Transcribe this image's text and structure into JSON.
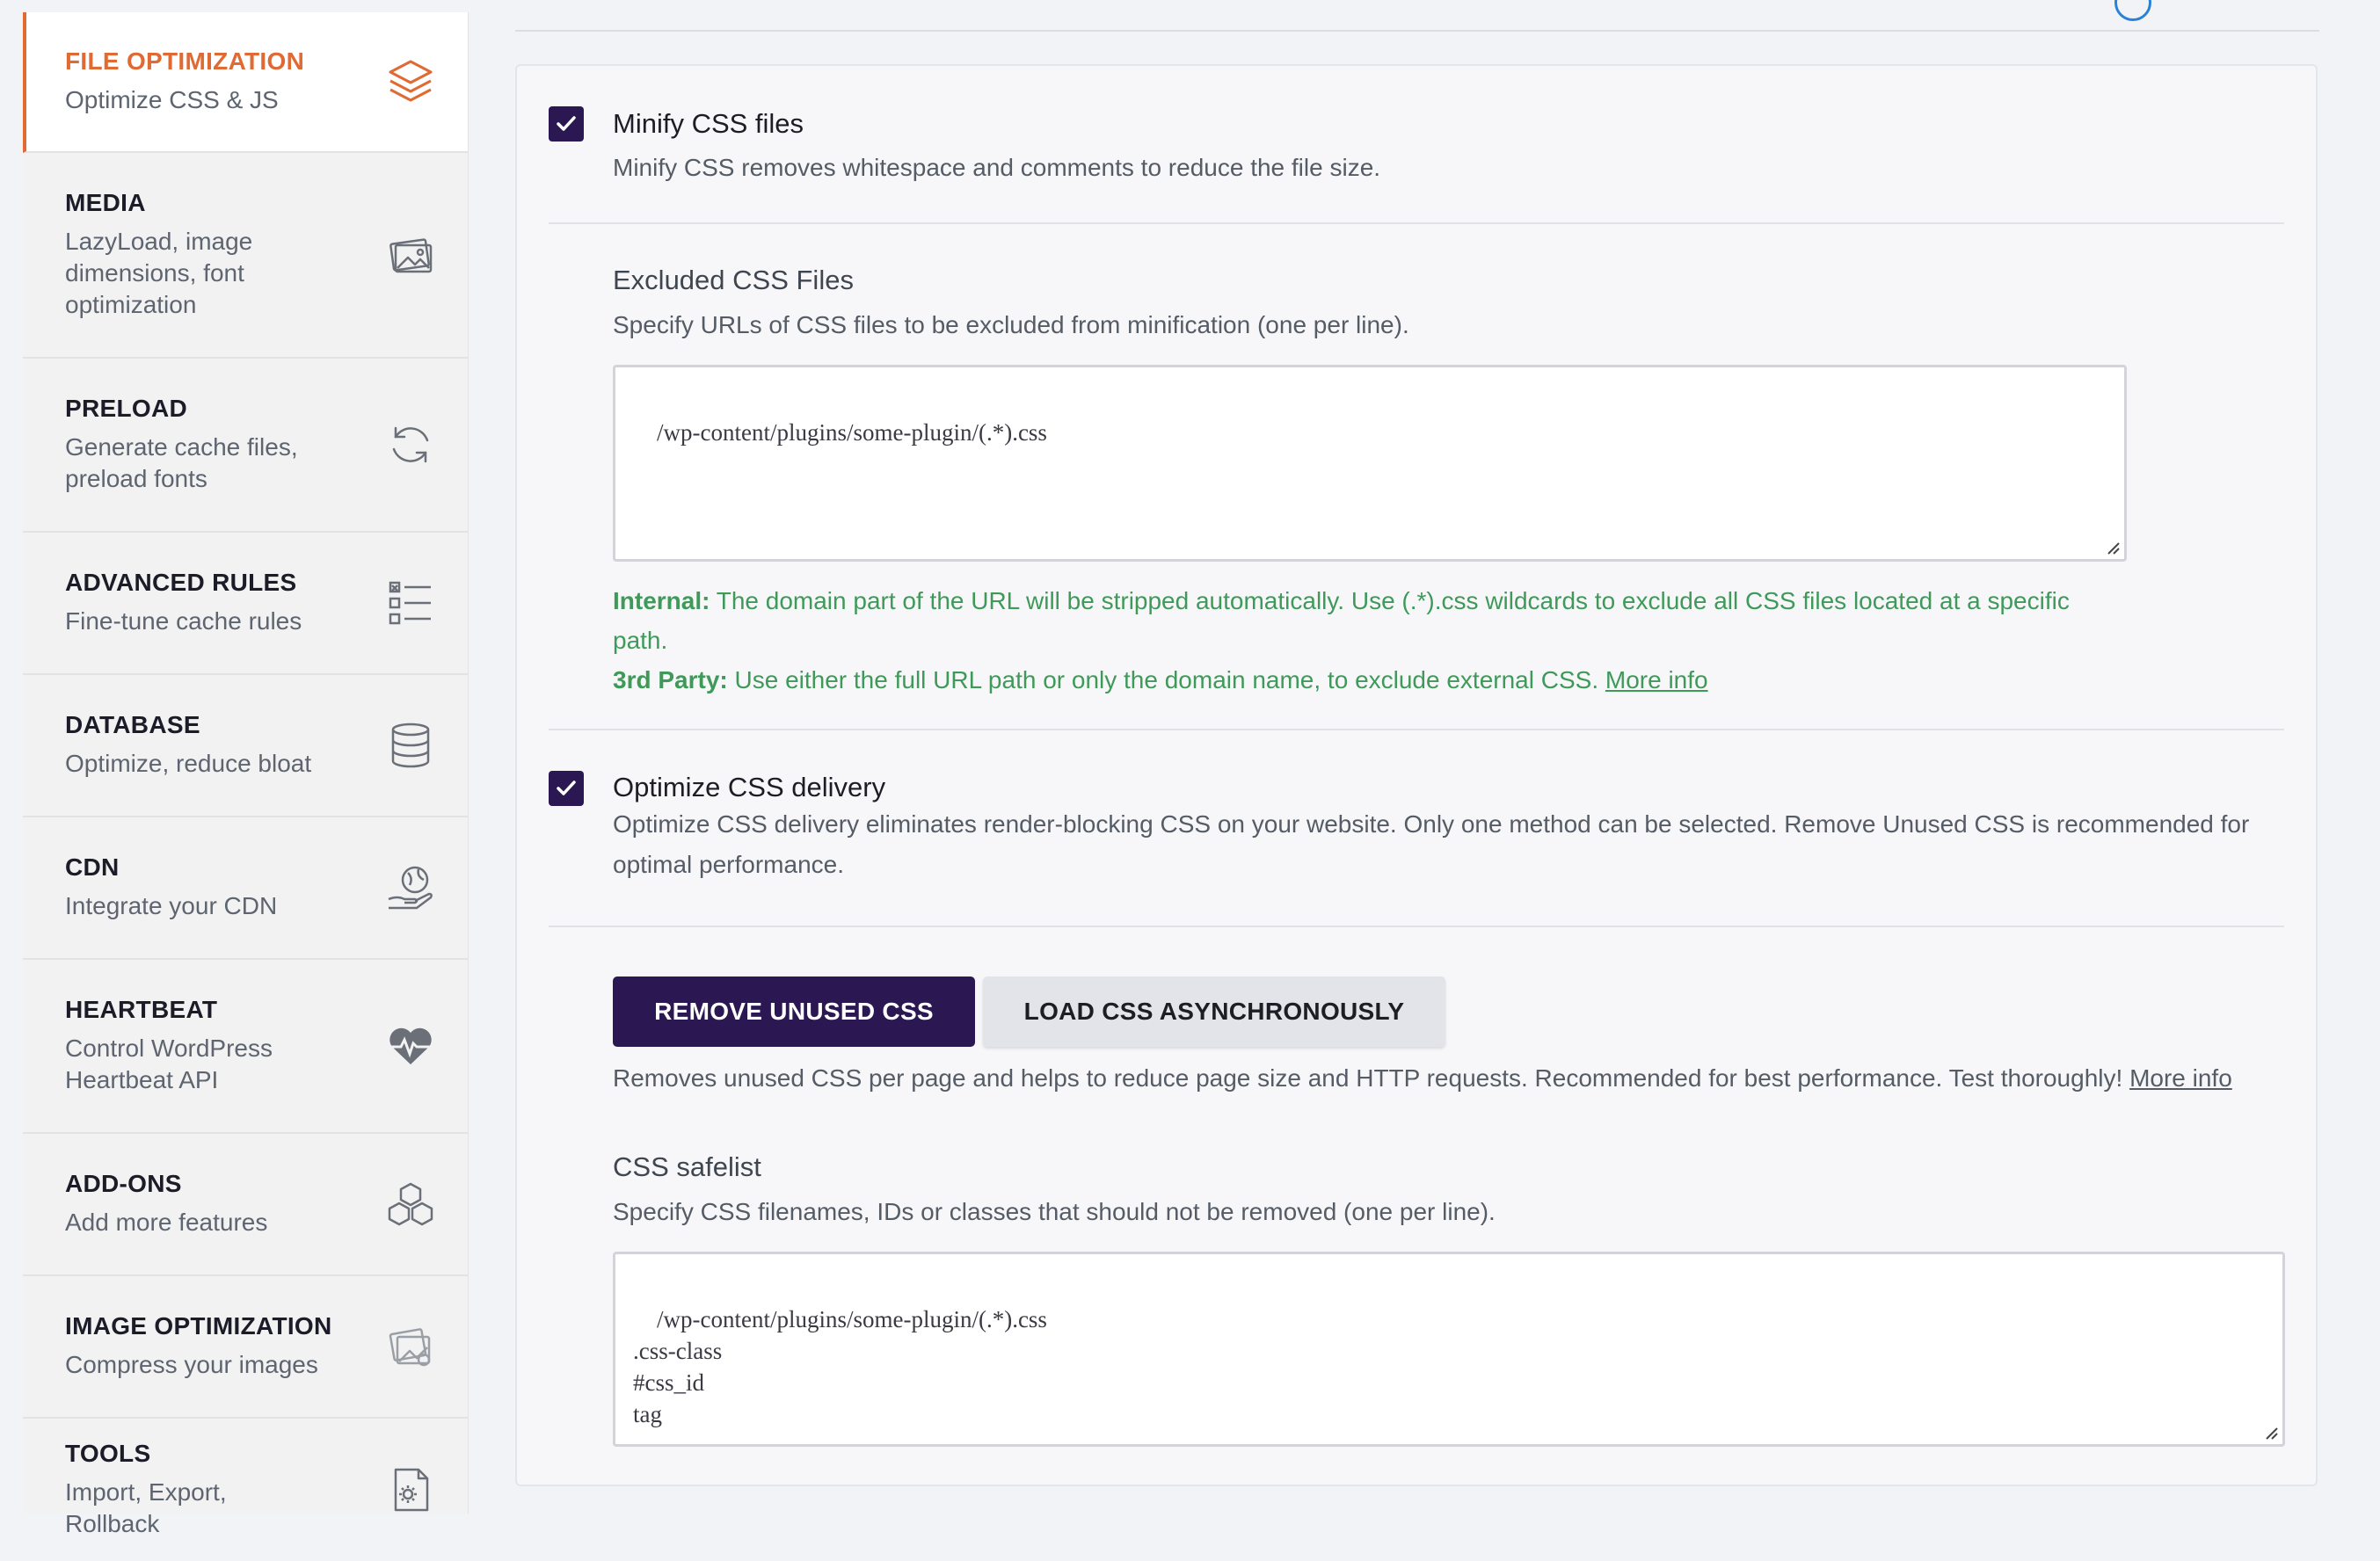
{
  "sidebar": {
    "items": [
      {
        "title": "FILE OPTIMIZATION",
        "subtitle": "Optimize CSS & JS",
        "icon": "layers-icon",
        "active": true
      },
      {
        "title": "MEDIA",
        "subtitle": "LazyLoad, image dimensions, font optimization",
        "icon": "images-icon"
      },
      {
        "title": "PRELOAD",
        "subtitle": "Generate cache files, preload fonts",
        "icon": "refresh-icon"
      },
      {
        "title": "ADVANCED RULES",
        "subtitle": "Fine-tune cache rules",
        "icon": "checklist-icon"
      },
      {
        "title": "DATABASE",
        "subtitle": "Optimize, reduce bloat",
        "icon": "database-icon"
      },
      {
        "title": "CDN",
        "subtitle": "Integrate your CDN",
        "icon": "globe-hand-icon"
      },
      {
        "title": "HEARTBEAT",
        "subtitle": "Control WordPress Heartbeat API",
        "icon": "heartbeat-icon"
      },
      {
        "title": "ADD-ONS",
        "subtitle": "Add more features",
        "icon": "cubes-icon"
      },
      {
        "title": "IMAGE OPTIMIZATION",
        "subtitle": "Compress your images",
        "icon": "image-optimize-icon"
      },
      {
        "title": "TOOLS",
        "subtitle": "Import, Export, Rollback",
        "icon": "file-gear-icon"
      }
    ]
  },
  "minify": {
    "checked": true,
    "title": "Minify CSS files",
    "description": "Minify CSS removes whitespace and comments to reduce the file size."
  },
  "excluded": {
    "title": "Excluded CSS Files",
    "description": "Specify URLs of CSS files to be excluded from minification (one per line).",
    "value": "/wp-content/plugins/some-plugin/(.*).css",
    "internal_label": "Internal:",
    "internal_text": " The domain part of the URL will be stripped automatically. Use (.*).css wildcards to exclude all CSS files located at a specific path.",
    "third_label": "3rd Party:",
    "third_text": " Use either the full URL path or only the domain name, to exclude external CSS. ",
    "more_info": "More info"
  },
  "delivery": {
    "checked": true,
    "title": "Optimize CSS delivery",
    "description": "Optimize CSS delivery eliminates render-blocking CSS on your website. Only one method can be selected. Remove Unused CSS is recommended for optimal performance.",
    "btn_remove": "REMOVE UNUSED CSS",
    "btn_async": "LOAD CSS ASYNCHRONOUSLY",
    "method_description": "Removes unused CSS per page and helps to reduce page size and HTTP requests. Recommended for best performance. Test thoroughly! ",
    "more_info": "More info"
  },
  "safelist": {
    "title": "CSS safelist",
    "description": "Specify CSS filenames, IDs or classes that should not be removed (one per line).",
    "value": "/wp-content/plugins/some-plugin/(.*).css\n.css-class\n#css_id\ntag"
  },
  "colors": {
    "accent": "#e06a33",
    "primary": "#2b1853",
    "success_text": "#3f9a5a"
  }
}
